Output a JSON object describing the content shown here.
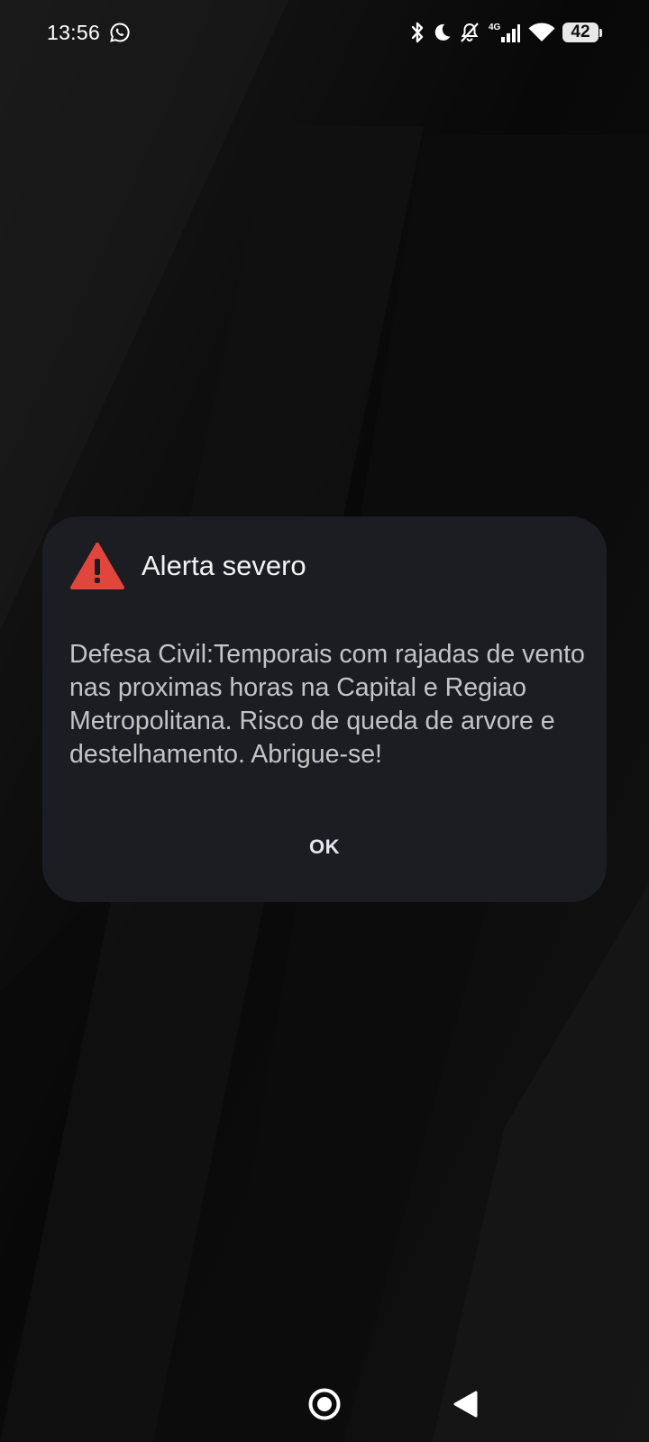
{
  "status_bar": {
    "time": "13:56",
    "battery_level": "42",
    "network_label": "4G",
    "icons": [
      "whatsapp-icon",
      "bluetooth-icon",
      "do-not-disturb-moon-icon",
      "vibrate-muted-icon",
      "cellular-signal-icon",
      "wifi-icon",
      "battery-icon"
    ]
  },
  "alert_dialog": {
    "title": "Alerta severo",
    "icon": "warning-triangle-icon",
    "message": "Defesa Civil:Temporais com rajadas de vento nas proximas horas na Capital e Regiao Metropolitana. Risco de queda de arvore e destelhamento. Abrigue-se!",
    "ok_label": "OK"
  },
  "nav_bar": {
    "buttons": [
      "home-button",
      "back-button"
    ]
  },
  "colors": {
    "background": "#070707",
    "dialog_background": "#1c1d22",
    "warning_red": "#e0463b",
    "title_text": "#f2f2f2",
    "message_text": "#c4c4c8"
  }
}
